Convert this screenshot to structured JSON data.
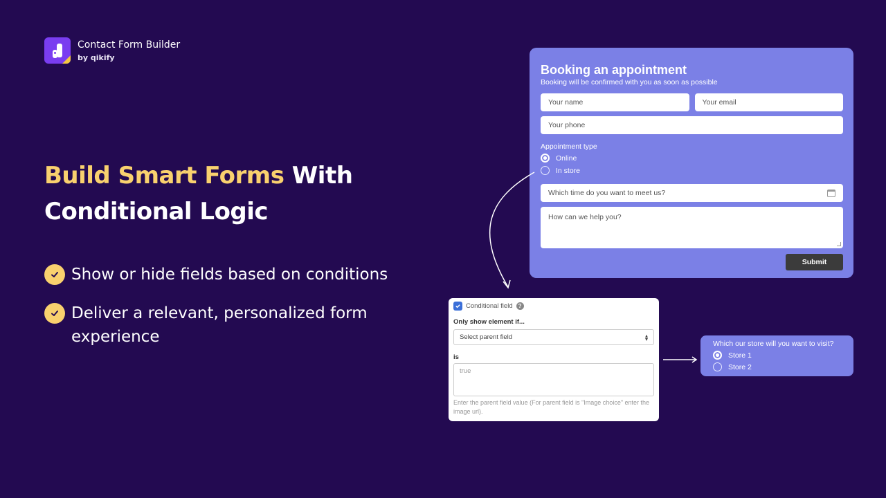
{
  "brand": {
    "name": "Contact Form Builder",
    "byline": "by qikify",
    "logo_icon": "qikify-logo-icon"
  },
  "headline": {
    "accent": "Build Smart Forms",
    "rest_line1": " With",
    "line2": "Conditional Logic"
  },
  "features": [
    {
      "icon": "check-circle-icon",
      "text": "Show or hide fields based on conditions"
    },
    {
      "icon": "check-circle-icon",
      "text": "Deliver a relevant, personalized form experience"
    }
  ],
  "booking_form": {
    "title": "Booking an appointment",
    "subtitle": "Booking will be confirmed with you as soon as possible",
    "name_placeholder": "Your name",
    "email_placeholder": "Your email",
    "phone_placeholder": "Your phone",
    "appointment_label": "Appointment type",
    "options": [
      {
        "label": "Online",
        "selected": true
      },
      {
        "label": "In store",
        "selected": false
      }
    ],
    "time_placeholder": "Which time do you want to meet us?",
    "message_placeholder": "How can we help you?",
    "submit_label": "Submit"
  },
  "conditional_panel": {
    "checkbox_label": "Conditional field",
    "checked": true,
    "help_glyph": "?",
    "condition_label": "Only show element if...",
    "select_value": "Select parent field",
    "is_label": "is",
    "value_placeholder": "true",
    "help_text": "Enter the parent field value (For parent field is \"Image choice\" enter the image url)."
  },
  "store_popup": {
    "question": "Which our store will you want to visit?",
    "options": [
      {
        "label": "Store 1",
        "selected": true
      },
      {
        "label": "Store 2",
        "selected": false
      }
    ]
  },
  "colors": {
    "background": "#230a51",
    "accent_yellow": "#f9d16e",
    "form_purple": "#7b80e6",
    "submit_dark": "#3b3b3b",
    "checkbox_blue": "#3b6fd8"
  }
}
